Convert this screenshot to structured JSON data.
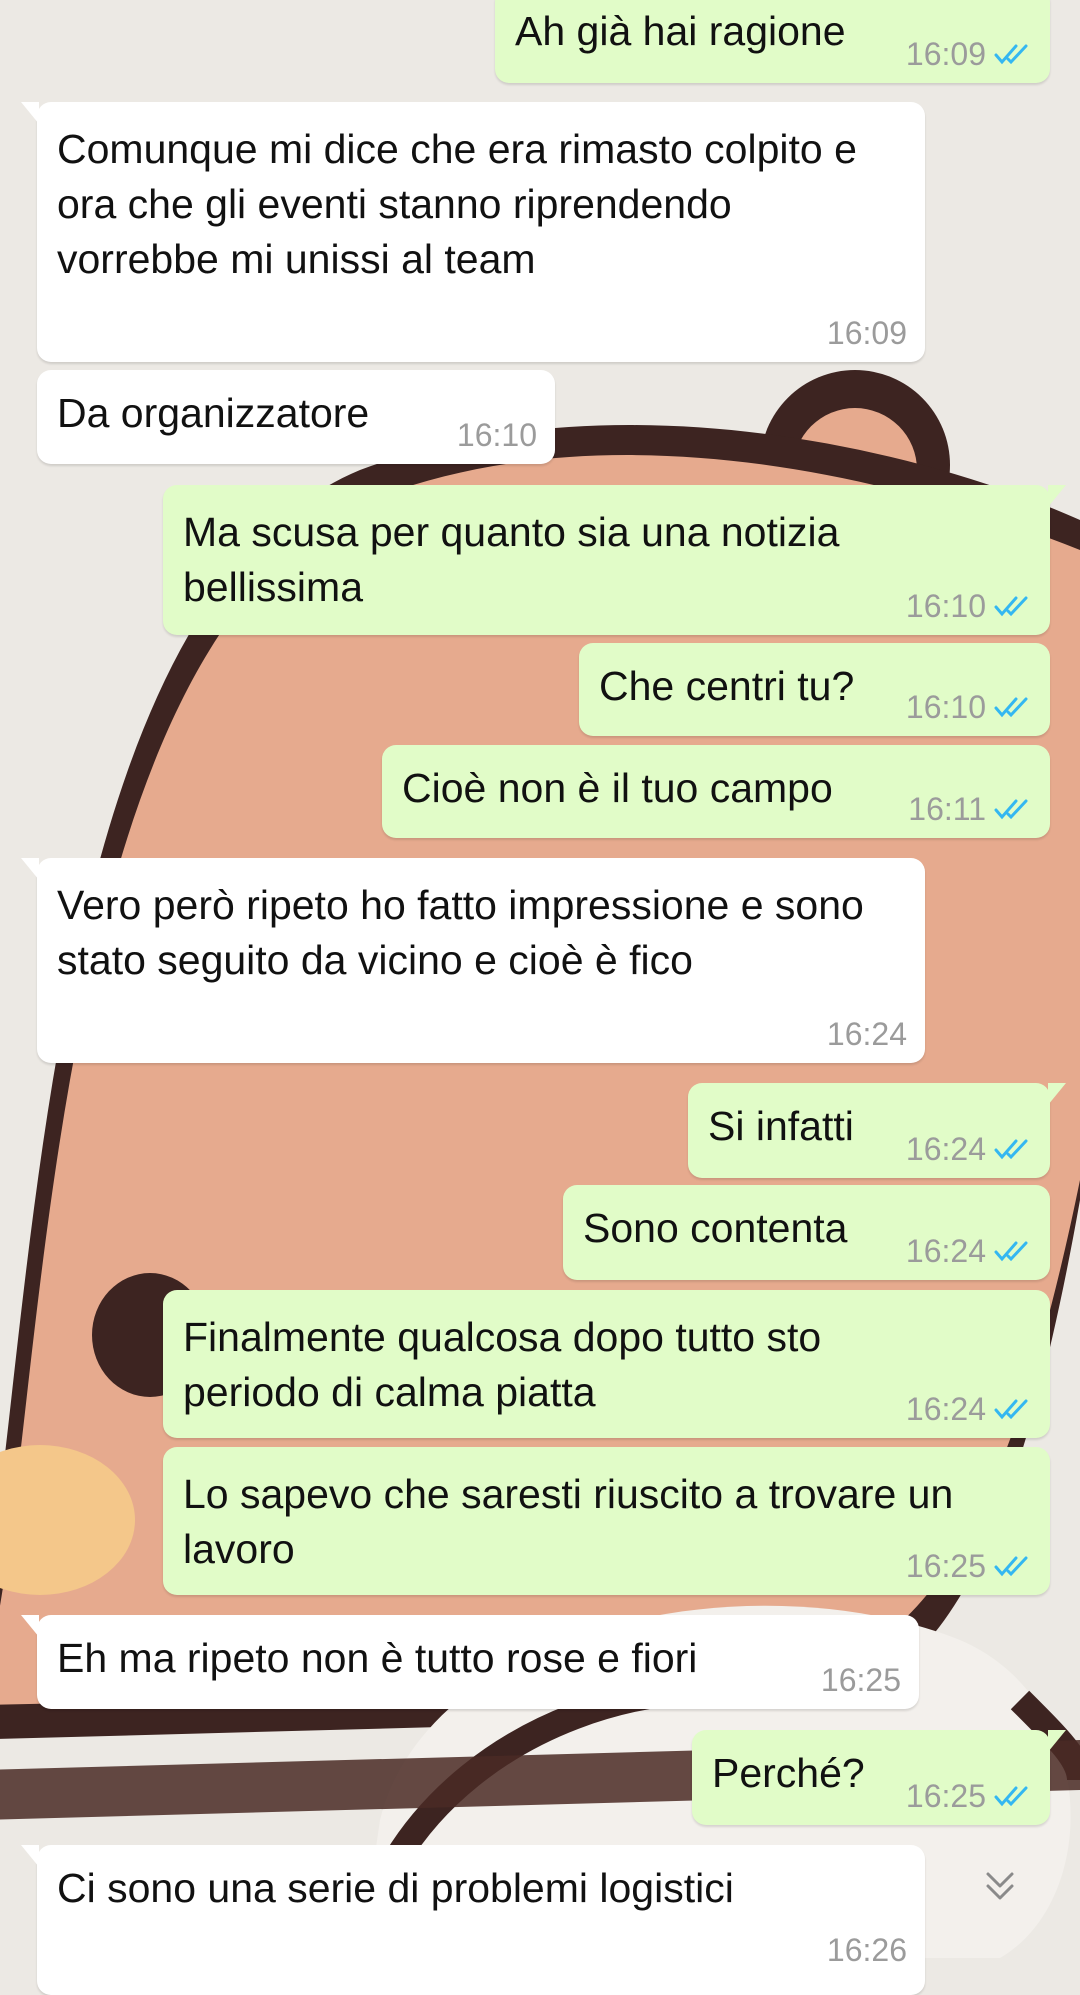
{
  "colors": {
    "incoming_bubble": "#ffffff",
    "outgoing_bubble": "#e1fcc8",
    "timestamp": "#9b9b9b",
    "read_ticks": "#34b7f1"
  },
  "messages": [
    {
      "direction": "out",
      "text": "Ah già hai ragione",
      "time": "16:09",
      "read": true
    },
    {
      "direction": "in",
      "text": "Comunque mi dice che era rimasto colpito e ora che gli eventi stanno riprendendo vorrebbe mi unissi al team",
      "time": "16:09"
    },
    {
      "direction": "in",
      "text": "Da organizzatore",
      "time": "16:10"
    },
    {
      "direction": "out",
      "text": "Ma scusa per quanto sia una notizia bellissima",
      "time": "16:10",
      "read": true
    },
    {
      "direction": "out",
      "text": "Che centri tu?",
      "time": "16:10",
      "read": true
    },
    {
      "direction": "out",
      "text": "Cioè non è il tuo campo",
      "time": "16:11",
      "read": true
    },
    {
      "direction": "in",
      "text": "Vero però ripeto ho fatto impressione e sono stato seguito da vicino e cioè è fico",
      "time": "16:24"
    },
    {
      "direction": "out",
      "text": "Si infatti",
      "time": "16:24",
      "read": true
    },
    {
      "direction": "out",
      "text": "Sono contenta",
      "time": "16:24",
      "read": true
    },
    {
      "direction": "out",
      "text": "Finalmente qualcosa dopo tutto sto periodo di calma piatta",
      "time": "16:24",
      "read": true
    },
    {
      "direction": "out",
      "text": "Lo sapevo che saresti riuscito a trovare un lavoro",
      "time": "16:25",
      "read": true
    },
    {
      "direction": "in",
      "text": "Eh ma ripeto non è tutto rose e fiori",
      "time": "16:25"
    },
    {
      "direction": "out",
      "text": "Perché?",
      "time": "16:25",
      "read": true
    },
    {
      "direction": "in",
      "text": "Ci sono una serie di problemi logistici",
      "time": "16:26"
    }
  ],
  "scroll_button_icon": "chevron-double-down-icon"
}
